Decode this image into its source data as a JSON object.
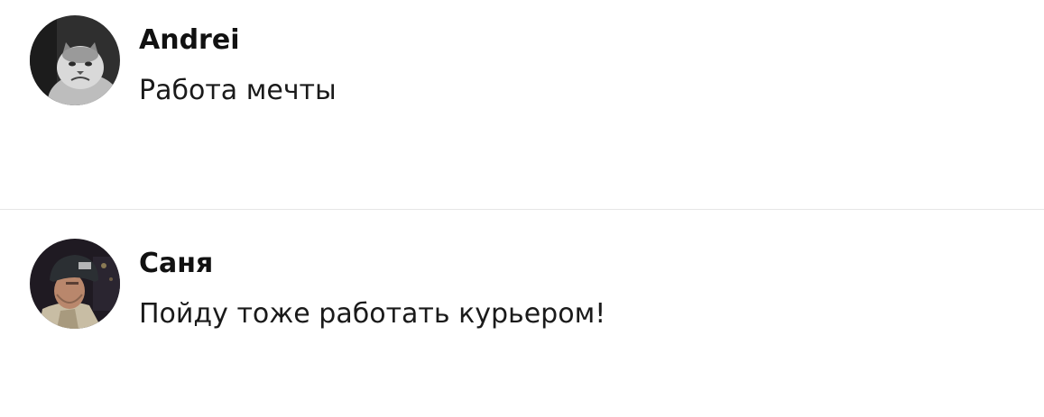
{
  "comments": [
    {
      "author": "Andrei",
      "text": "Работа мечты",
      "avatar": "grumpy-cat-photo"
    },
    {
      "author": "Саня",
      "text": "Пойду тоже работать курьером!",
      "avatar": "soldier-helmet-photo"
    }
  ]
}
